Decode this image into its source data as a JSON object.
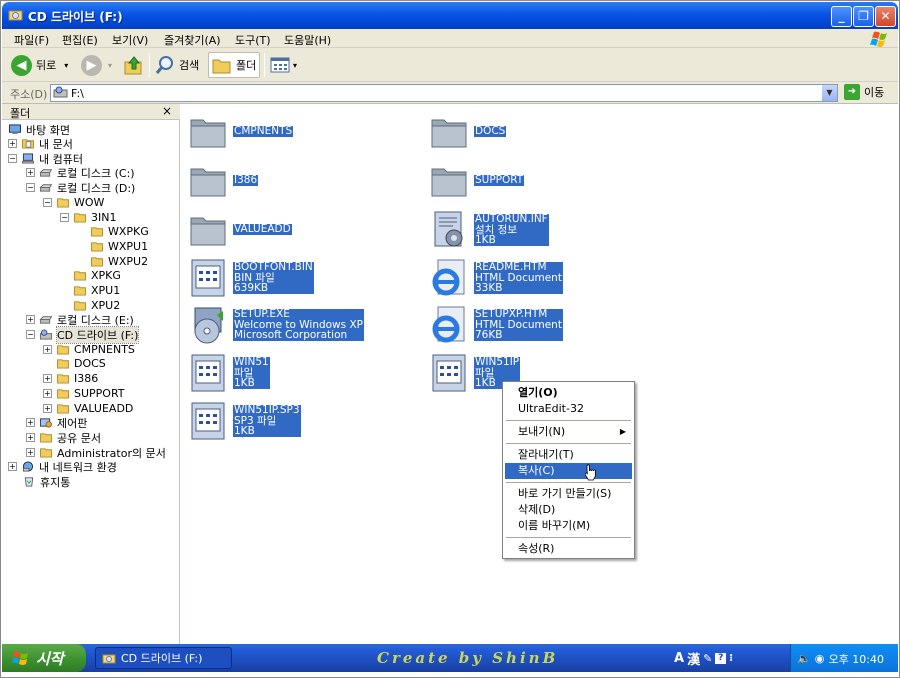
{
  "window": {
    "title": "CD 드라이브 (F:)"
  },
  "menubar": {
    "items": [
      "파일(F)",
      "편집(E)",
      "보기(V)",
      "즐겨찾기(A)",
      "도구(T)",
      "도움말(H)"
    ]
  },
  "toolbar": {
    "back_label": "뒤로",
    "search_label": "검색",
    "folders_label": "폴더"
  },
  "address": {
    "label": "주소(D)",
    "value": "F:\\",
    "go_label": "이동"
  },
  "folder_pane": {
    "title": "폴더",
    "close": "×",
    "tree": [
      {
        "label": "바탕 화면"
      },
      {
        "label": "내 문서"
      },
      {
        "label": "내 컴퓨터"
      },
      {
        "label": "로컬 디스크 (C:)"
      },
      {
        "label": "로컬 디스크 (D:)"
      },
      {
        "label": "WOW"
      },
      {
        "label": "3IN1"
      },
      {
        "label": "WXPKG"
      },
      {
        "label": "WXPU1"
      },
      {
        "label": "WXPU2"
      },
      {
        "label": "XPKG"
      },
      {
        "label": "XPU1"
      },
      {
        "label": "XPU2"
      },
      {
        "label": "로컬 디스크 (E:)"
      },
      {
        "label": "CD 드라이브 (F:)"
      },
      {
        "label": "CMPNENTS"
      },
      {
        "label": "DOCS"
      },
      {
        "label": "I386"
      },
      {
        "label": "SUPPORT"
      },
      {
        "label": "VALUEADD"
      },
      {
        "label": "제어판"
      },
      {
        "label": "공유 문서"
      },
      {
        "label": "Administrator의 문서"
      },
      {
        "label": "내 네트워크 환경"
      },
      {
        "label": "휴지통"
      }
    ]
  },
  "files": [
    {
      "icon": "folder-icon",
      "lines": [
        "CMPNENTS"
      ]
    },
    {
      "icon": "folder-icon",
      "lines": [
        "DOCS"
      ]
    },
    {
      "icon": "folder-icon",
      "lines": [
        "I386"
      ]
    },
    {
      "icon": "folder-icon",
      "lines": [
        "SUPPORT"
      ]
    },
    {
      "icon": "folder-icon",
      "lines": [
        "VALUEADD"
      ]
    },
    {
      "icon": "setup-info-icon",
      "lines": [
        "AUTORUN.INF",
        "설치 정보",
        "1KB"
      ]
    },
    {
      "icon": "generic-file-icon",
      "lines": [
        "BOOTFONT.BIN",
        "BIN 파일",
        "639KB"
      ]
    },
    {
      "icon": "ie-document-icon",
      "lines": [
        "README.HTM",
        "HTML Document",
        "33KB"
      ]
    },
    {
      "icon": "setup-cd-icon",
      "lines": [
        "SETUP.EXE",
        "Welcome to Windows XP",
        "Microsoft Corporation"
      ]
    },
    {
      "icon": "ie-document-icon",
      "lines": [
        "SETUPXP.HTM",
        "HTML Document",
        "76KB"
      ]
    },
    {
      "icon": "generic-file-icon",
      "lines": [
        "WIN51",
        "파일",
        "1KB"
      ]
    },
    {
      "icon": "generic-file-icon",
      "lines": [
        "WIN51IP",
        "파일",
        "1KB"
      ]
    },
    {
      "icon": "generic-file-icon",
      "lines": [
        "WIN51IP.SP3",
        "SP3 파일",
        "1KB"
      ]
    }
  ],
  "context_menu": {
    "items": [
      {
        "label": "열기(O)",
        "bold": true
      },
      {
        "label": "UltraEdit-32"
      },
      {
        "label": "보내기(N)",
        "submenu": true
      },
      {
        "label": "잘라내기(T)"
      },
      {
        "label": "복사(C)",
        "highlighted": true
      },
      {
        "label": "바로 가기 만들기(S)"
      },
      {
        "label": "삭제(D)"
      },
      {
        "label": "이름 바꾸기(M)"
      },
      {
        "label": "속성(R)"
      }
    ]
  },
  "taskbar": {
    "start_label": "시작",
    "task_label": "CD 드라이브 (F:)",
    "watermark": "Create by ShinB",
    "lang_a": "A",
    "lang_han": "漢",
    "clock": "오후 10:40"
  },
  "colors": {
    "selection": "#316ac5",
    "titlebar": "#0a54e3",
    "chrome": "#ece9d8",
    "taskbar": "#245edb",
    "start": "#3c8f2f"
  }
}
